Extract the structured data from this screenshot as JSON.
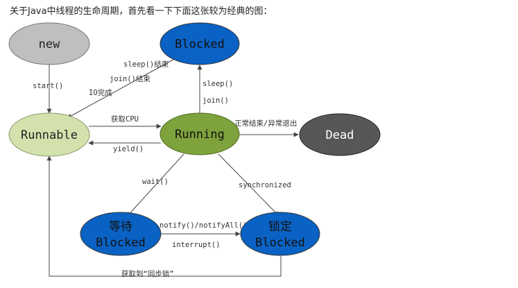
{
  "header": "关于Java中线程的生命周期，首先看一下下面这张较为经典的图：",
  "nodes": {
    "new": "new",
    "blocked": "Blocked",
    "runnable": "Runnable",
    "running": "Running",
    "dead": "Dead",
    "wait_blocked_line1": "等待",
    "wait_blocked_line2": "Blocked",
    "lock_blocked_line1": "锁定",
    "lock_blocked_line2": "Blocked"
  },
  "edges": {
    "start": "start()",
    "sleep_end": "sleep()结束",
    "join_end": "join()结束",
    "io_done": "IO完成",
    "get_cpu": "获取CPU",
    "yield": "yield()",
    "sleep": "sleep()",
    "join": "join()",
    "dead_reason": "正常结束/异常退出",
    "wait": "wait()",
    "synchronized": "synchronized",
    "notify": "notify()/notifyAll()",
    "interrupt": "interrupt()",
    "get_lock": "获取到“同步锁”"
  },
  "colors": {
    "new": "#bfbfbf",
    "blocked": "#0a62c4",
    "runnable": "#d3e2ad",
    "running": "#7fa33c",
    "dead": "#575757",
    "wait_blocked": "#0a62c4",
    "lock_blocked": "#0a62c4",
    "line": "#444444"
  }
}
